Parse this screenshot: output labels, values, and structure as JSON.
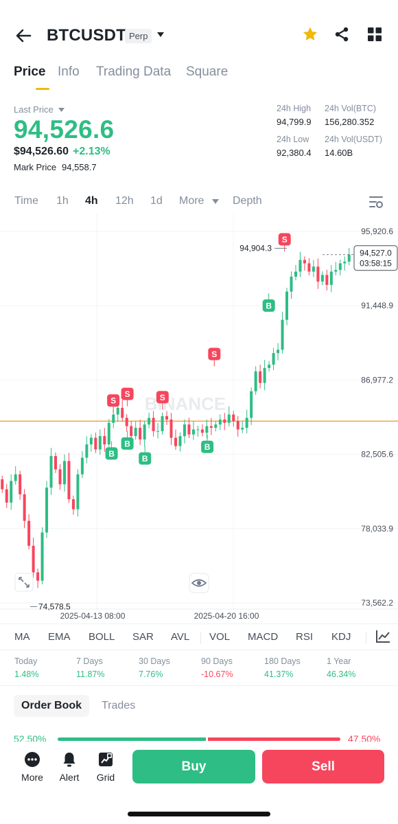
{
  "header": {
    "symbol": "BTCUSDT",
    "badge": "Perp"
  },
  "tabs": [
    {
      "label": "Price",
      "active": true
    },
    {
      "label": "Info"
    },
    {
      "label": "Trading Data"
    },
    {
      "label": "Square"
    }
  ],
  "ticker": {
    "last_price_label": "Last Price",
    "last_price": "94,526.6",
    "usd_price": "$94,526.60",
    "change_pct": "+2.13%",
    "mark_price_label": "Mark Price",
    "mark_price": "94,558.7",
    "high_label": "24h High",
    "high": "94,799.9",
    "low_label": "24h Low",
    "low": "92,380.4",
    "vol_btc_label": "24h Vol(BTC)",
    "vol_btc": "156,280.352",
    "vol_usdt_label": "24h Vol(USDT)",
    "vol_usdt": "14.60B"
  },
  "intervals": [
    "Time",
    "1h",
    "4h",
    "12h",
    "1d",
    "More",
    "Depth"
  ],
  "active_interval": "4h",
  "chart_data": {
    "type": "candlestick",
    "watermark": "BINANCE",
    "y_ticks": [
      "95,920.6",
      "91,448.9",
      "86,977.2",
      "82,505.6",
      "78,033.9",
      "73,562.2"
    ],
    "ylim": [
      73562.2,
      95920.6
    ],
    "x_ticks": [
      "2025-04-13 08:00",
      "2025-04-20 16:00"
    ],
    "high_marker": "94,904.3",
    "low_marker": "74,578.5",
    "current_price": "94,527.0",
    "countdown": "03:58:15",
    "horizontal_line_value": 84500,
    "closes": [
      80400,
      79600,
      80900,
      81300,
      80100,
      78500,
      77000,
      75400,
      74900,
      77800,
      80500,
      82400,
      81600,
      80700,
      82100,
      79800,
      79200,
      81300,
      82300,
      83100,
      83500,
      82800,
      83600,
      83100,
      84400,
      84900,
      85300,
      84700,
      84200,
      83600,
      84100,
      83400,
      84300,
      84700,
      83900,
      83900,
      84800,
      84600,
      83500,
      83000,
      83600,
      84300,
      83700,
      84000,
      84000,
      83800,
      84200,
      84100,
      84300,
      84600,
      84400,
      84900,
      84500,
      84000,
      84100,
      84700,
      86300,
      87500,
      86800,
      87700,
      87900,
      88600,
      88800,
      90600,
      92300,
      93200,
      93500,
      94200,
      94000,
      93500,
      93800,
      92900,
      93300,
      92700,
      93500,
      93600,
      94000,
      94100,
      94527
    ],
    "signals": [
      {
        "label": "B",
        "x": 0.3175,
        "y": 83300,
        "kind": "buy"
      },
      {
        "label": "S",
        "x": 0.3225,
        "y": 85000,
        "kind": "sell"
      },
      {
        "label": "S",
        "x": 0.3625,
        "y": 85400,
        "kind": "sell"
      },
      {
        "label": "B",
        "x": 0.3625,
        "y": 83900,
        "kind": "buy"
      },
      {
        "label": "S",
        "x": 0.4625,
        "y": 85200,
        "kind": "sell"
      },
      {
        "label": "B",
        "x": 0.4125,
        "y": 83000,
        "kind": "buy"
      },
      {
        "label": "B",
        "x": 0.59,
        "y": 83700,
        "kind": "buy"
      },
      {
        "label": "S",
        "x": 0.61,
        "y": 87800,
        "kind": "sell"
      },
      {
        "label": "B",
        "x": 0.765,
        "y": 92200,
        "kind": "buy"
      },
      {
        "label": "S",
        "x": 0.81,
        "y": 94700,
        "kind": "sell"
      }
    ]
  },
  "indicators": [
    "MA",
    "EMA",
    "BOLL",
    "SAR",
    "AVL",
    "VOL",
    "MACD",
    "RSI",
    "KDJ"
  ],
  "performance": [
    {
      "label": "Today",
      "value": "1.48%",
      "dir": "up"
    },
    {
      "label": "7 Days",
      "value": "11.87%",
      "dir": "up"
    },
    {
      "label": "30 Days",
      "value": "7.76%",
      "dir": "up"
    },
    {
      "label": "90 Days",
      "value": "-10.67%",
      "dir": "down"
    },
    {
      "label": "180 Days",
      "value": "41.37%",
      "dir": "up"
    },
    {
      "label": "1 Year",
      "value": "46.34%",
      "dir": "up"
    }
  ],
  "order_tabs": [
    {
      "label": "Order Book",
      "active": true
    },
    {
      "label": "Trades"
    }
  ],
  "order_ratio": {
    "buy": "52.50%",
    "sell": "47.50%",
    "buy_fraction": 0.525
  },
  "footer": {
    "more": "More",
    "alert": "Alert",
    "grid": "Grid",
    "buy": "Buy",
    "sell": "Sell"
  },
  "colors": {
    "up": "#2ebd85",
    "down": "#f6465d",
    "accent": "#f0b90b"
  }
}
